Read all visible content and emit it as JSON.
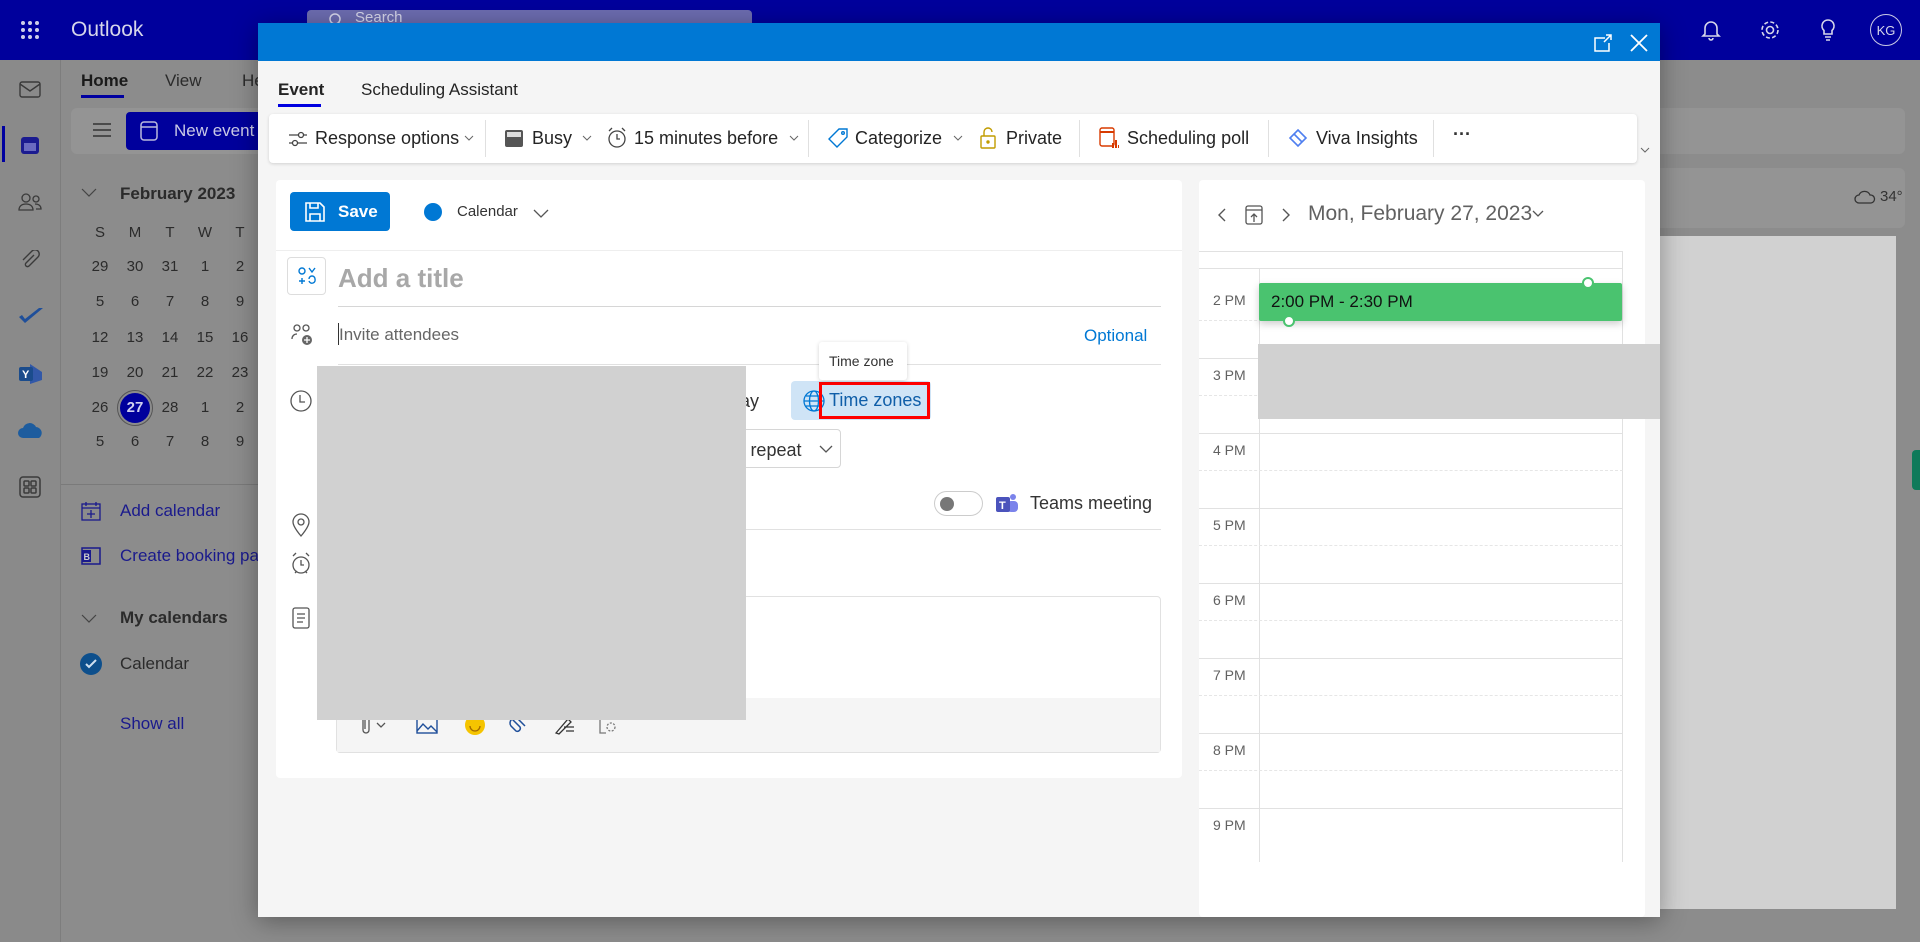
{
  "app": {
    "title": "Outlook",
    "search_placeholder": "Search",
    "avatar_initials": "KG"
  },
  "ribbon": {
    "tabs": [
      "Home",
      "View",
      "He"
    ],
    "new_event": "New event"
  },
  "mini_calendar": {
    "month": "February 2023",
    "weekdays": [
      "S",
      "M",
      "T",
      "W",
      "T"
    ],
    "weeks": [
      [
        "29",
        "30",
        "31",
        "1",
        "2"
      ],
      [
        "5",
        "6",
        "7",
        "8",
        "9"
      ],
      [
        "12",
        "13",
        "14",
        "15",
        "16"
      ],
      [
        "19",
        "20",
        "21",
        "22",
        "23"
      ],
      [
        "26",
        "27",
        "28",
        "1",
        "2"
      ],
      [
        "5",
        "6",
        "7",
        "8",
        "9"
      ]
    ],
    "selected": "27"
  },
  "sidebar": {
    "add_calendar": "Add calendar",
    "create_booking": "Create booking pa",
    "my_calendars": "My calendars",
    "calendar": "Calendar",
    "show_all": "Show all"
  },
  "weather": "34°",
  "dialog": {
    "tabs": [
      "Event",
      "Scheduling Assistant"
    ],
    "toolbar": {
      "response_options": "Response options",
      "busy": "Busy",
      "reminder": "15 minutes before",
      "categorize": "Categorize",
      "private": "Private",
      "scheduling_poll": "Scheduling poll",
      "viva_insights": "Viva Insights",
      "more": "···"
    },
    "save": "Save",
    "calendar_name": "Calendar",
    "calendar_color": "#0078d4",
    "title_placeholder": "Add a title",
    "attendees_placeholder": "Invite attendees",
    "optional": "Optional",
    "all_day_partial": "day",
    "time_zones": "Time zones",
    "tooltip": "Time zone",
    "repeat_partial": "'t repeat",
    "teams_meeting": "Teams meeting",
    "teams_toggle_on": false
  },
  "day_view": {
    "date": "Mon, February 27, 2023",
    "hours": [
      "2 PM",
      "3 PM",
      "4 PM",
      "5 PM",
      "6 PM",
      "7 PM",
      "8 PM",
      "9 PM"
    ],
    "event": {
      "label": "2:00 PM - 2:30 PM",
      "color": "#4ac36f"
    }
  },
  "colors": {
    "accent": "#0078d4",
    "topbar": "#00009c",
    "highlight": "#ff0000"
  }
}
